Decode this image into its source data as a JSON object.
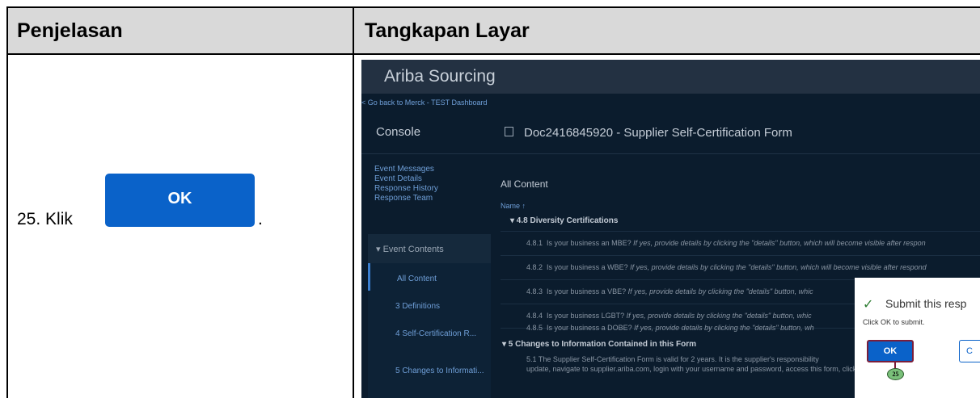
{
  "table": {
    "header_left": "Penjelasan",
    "header_right": "Tangkapan Layar"
  },
  "step": {
    "text": "25. Klik",
    "button_label": "OK",
    "period": "."
  },
  "screenshot": {
    "app_title": "Ariba Sourcing",
    "back_link": "< Go back to Merck - TEST Dashboard",
    "console": "Console",
    "doc_title": "Doc2416845920 - Supplier Self-Certification Form",
    "side_links": [
      "Event Messages",
      "Event Details",
      "Response History",
      "Response Team"
    ],
    "event_contents": "▾ Event Contents",
    "side_items": [
      {
        "label": "All Content"
      },
      {
        "label": "3  Definitions"
      },
      {
        "label": "4  Self-Certification R..."
      },
      {
        "label": "5  Changes to Informati..."
      }
    ],
    "all_content": "All Content",
    "name_header": "Name ↑",
    "section_48": "▾ 4.8  Diversity Certifications",
    "rows": [
      {
        "num": "4.8.1",
        "q": "Is your business an MBE?",
        "hint": "If yes, provide details by clicking the \"details\" button, which will become visible after respon"
      },
      {
        "num": "4.8.2",
        "q": "Is your business a WBE?",
        "hint": "If yes, provide details by clicking the \"details\" button, which will become visible after respond"
      },
      {
        "num": "4.8.3",
        "q": "Is your business a VBE?",
        "hint": "If yes, provide details by clicking the \"details\" button, whic"
      },
      {
        "num": "4.8.4",
        "q": "Is your business LGBT?",
        "hint": "If yes, provide details by clicking the \"details\" button, whic"
      },
      {
        "num": "4.8.5",
        "q": "Is your business a DOBE?",
        "hint": "If yes, provide details by clicking the \"details\" button, wh"
      }
    ],
    "section_5": "▾ 5  Changes to Information Contained in this Form",
    "section_51": "5.1  The Supplier Self-Certification Form is valid for 2 years. It is the supplier's responsibility",
    "section_51_line2": "update, navigate to supplier.ariba.com, login with your username and password, access this form, click \"revise response\", make",
    "dialog": {
      "title": "Submit this resp",
      "subtitle": "Click OK to submit.",
      "ok_label": "OK",
      "cancel_label": "C",
      "badge": "25"
    }
  }
}
